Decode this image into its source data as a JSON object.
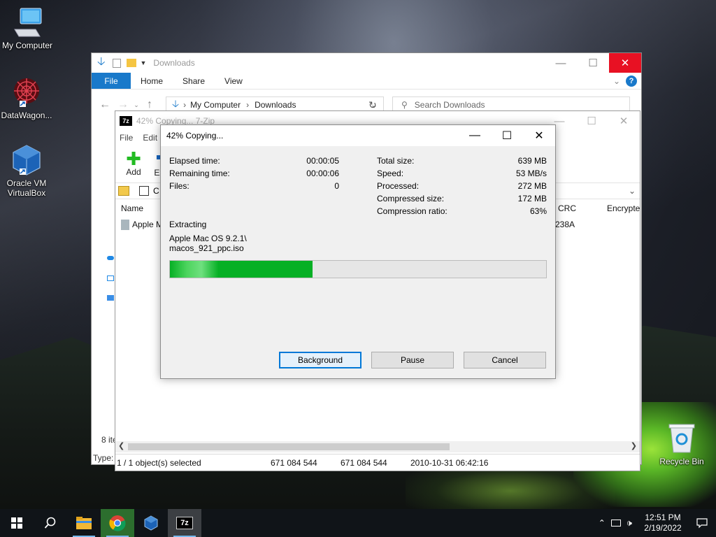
{
  "desktop": {
    "icons": [
      {
        "label": "My Computer"
      },
      {
        "label": "DataWagon..."
      },
      {
        "label": "Oracle VM VirtualBox"
      },
      {
        "label": "Recycle Bin"
      }
    ]
  },
  "explorer": {
    "title": "Downloads",
    "ribbon": {
      "file": "File",
      "home": "Home",
      "share": "Share",
      "view": "View"
    },
    "breadcrumb": [
      "My Computer",
      "Downloads"
    ],
    "search_placeholder": "Search Downloads",
    "status_items": "8 ite",
    "status_type": "Type:"
  },
  "zip": {
    "title": "42% Copying... 7-Zip",
    "menu": {
      "file": "File",
      "edit": "Edit"
    },
    "toolbar": {
      "add": "Add",
      "extract": "Extr"
    },
    "path_prefix": "C",
    "columns": {
      "name": "Name",
      "crc": "CRC",
      "encrypted": "Encrypte"
    },
    "row": {
      "name": "Apple M",
      "crc": "238A"
    },
    "status": {
      "selected": "1 / 1 object(s) selected",
      "size": "671 084 544",
      "packed": "671 084 544",
      "modified": "2010-10-31 06:42:16"
    }
  },
  "dialog": {
    "title": "42% Copying...",
    "left_stats": [
      {
        "label": "Elapsed time:",
        "value": "00:00:05"
      },
      {
        "label": "Remaining time:",
        "value": "00:00:06"
      },
      {
        "label": "Files:",
        "value": "0"
      }
    ],
    "right_stats": [
      {
        "label": "Total size:",
        "value": "639 MB"
      },
      {
        "label": "Speed:",
        "value": "53 MB/s"
      },
      {
        "label": "Processed:",
        "value": "272 MB"
      },
      {
        "label": "Compressed size:",
        "value": "172 MB"
      },
      {
        "label": "Compression ratio:",
        "value": "63%"
      }
    ],
    "operation": "Extracting",
    "file_line1": "Apple Mac OS 9.2.1\\",
    "file_line2": "macos_921_ppc.iso",
    "progress": 0.38,
    "buttons": {
      "background": "Background",
      "pause": "Pause",
      "cancel": "Cancel"
    }
  },
  "taskbar": {
    "time": "12:51 PM",
    "date": "2/19/2022"
  }
}
